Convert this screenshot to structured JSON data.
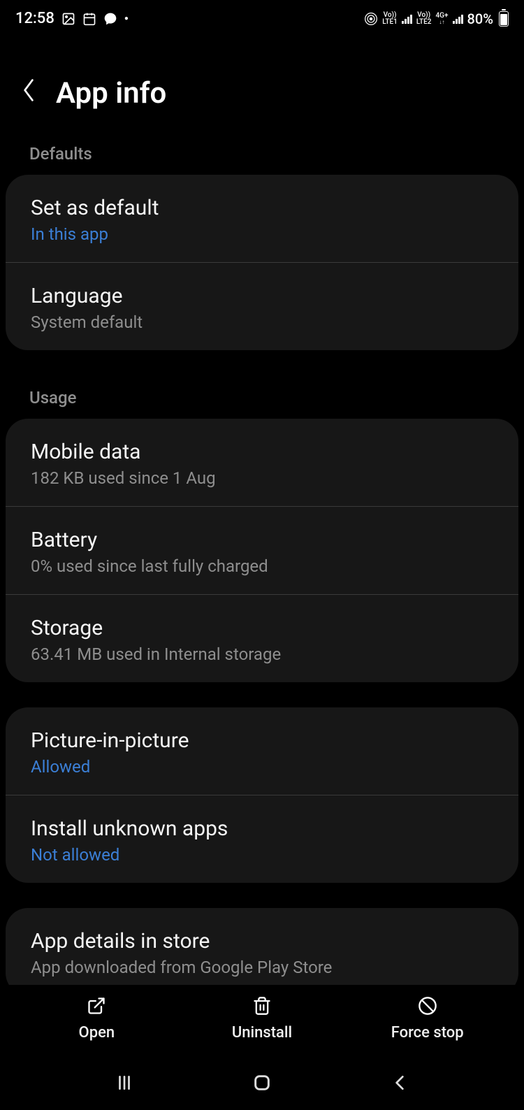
{
  "statusBar": {
    "time": "12:58",
    "battery": "80%",
    "sim1": "LTE1",
    "sim2": "LTE2",
    "net": "4G+",
    "vo": "Vo))"
  },
  "header": {
    "title": "App info"
  },
  "sections": {
    "defaults": {
      "label": "Defaults",
      "items": [
        {
          "title": "Set as default",
          "sub": "In this app",
          "link": true
        },
        {
          "title": "Language",
          "sub": "System default",
          "link": false
        }
      ]
    },
    "usage": {
      "label": "Usage",
      "items": [
        {
          "title": "Mobile data",
          "sub": "182 KB used since 1 Aug",
          "link": false
        },
        {
          "title": "Battery",
          "sub": "0% used since last fully charged",
          "link": false
        },
        {
          "title": "Storage",
          "sub": "63.41 MB used in Internal storage",
          "link": false
        }
      ]
    },
    "permissions": {
      "items": [
        {
          "title": "Picture-in-picture",
          "sub": "Allowed",
          "link": true
        },
        {
          "title": "Install unknown apps",
          "sub": "Not allowed",
          "link": true
        }
      ]
    },
    "store": {
      "items": [
        {
          "title": "App details in store",
          "sub": "App downloaded from Google Play Store",
          "link": false
        }
      ]
    }
  },
  "actions": {
    "open": "Open",
    "uninstall": "Uninstall",
    "forceStop": "Force stop"
  }
}
